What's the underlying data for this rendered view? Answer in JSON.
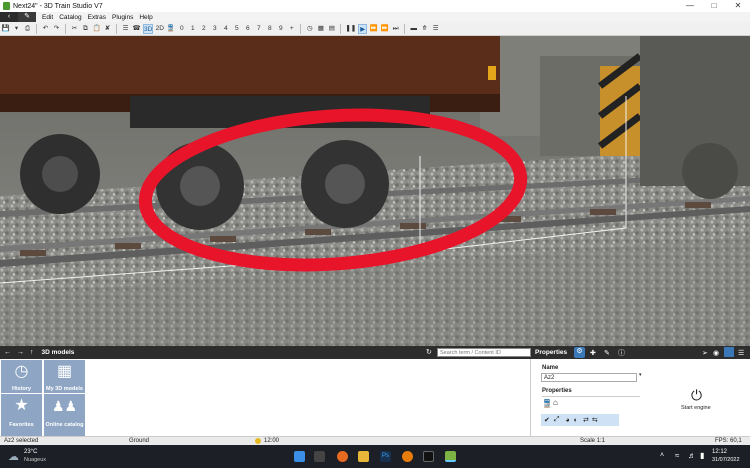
{
  "window": {
    "title": "Next24\" - 3D Train Studio V7"
  },
  "menu": {
    "items": [
      "Edit",
      "Catalog",
      "Extras",
      "Plugins",
      "Help"
    ]
  },
  "toolbar": {
    "view3d": "3D",
    "view2d": "2D",
    "numbers": [
      "0",
      "1",
      "2",
      "3",
      "4",
      "5",
      "6",
      "7",
      "8",
      "9"
    ],
    "plus": "+"
  },
  "library": {
    "title": "3D models",
    "search_placeholder": "Search term / Content ID",
    "tiles": [
      "History",
      "My 3D models",
      "Favorites",
      "Online catalog"
    ]
  },
  "properties": {
    "title": "Properties",
    "name_label": "Name",
    "name_value": "Az2",
    "section_label": "Properties",
    "start_engine": "Start engine"
  },
  "status": {
    "selected": "Az2 selected",
    "layer": "Ground",
    "time": "12:00",
    "scale": "Scale 1:1",
    "fps": "FPS: 60,1"
  },
  "taskbar": {
    "temp": "23°C",
    "weather": "Nuageux",
    "clock": "12:12",
    "date": "31/07/2022"
  },
  "colors": {
    "highlight_ring": "#e8142a",
    "panel_dark": "#2d2d2d",
    "tile": "#8ea6c3",
    "taskbar": "#1c1f26"
  }
}
